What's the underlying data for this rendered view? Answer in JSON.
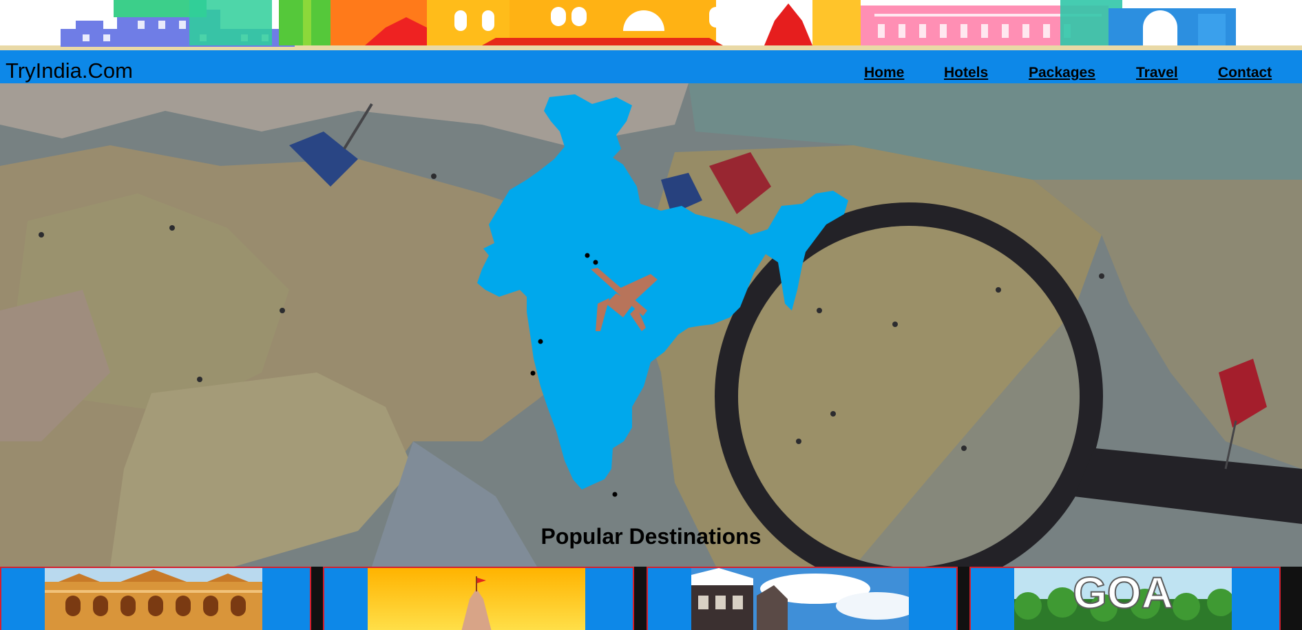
{
  "site": {
    "brand": "TryIndia.Com"
  },
  "nav": {
    "items": [
      {
        "label": "Home"
      },
      {
        "label": "Hotels"
      },
      {
        "label": "Packages"
      },
      {
        "label": "Travel"
      },
      {
        "label": "Contact"
      }
    ]
  },
  "hero": {
    "section_title": "Popular Destinations"
  },
  "cards": [
    {
      "image": "rajasthan-palace"
    },
    {
      "image": "temple-spire"
    },
    {
      "image": "hill-station"
    },
    {
      "image": "goa",
      "logo_text": "GOA"
    }
  ],
  "colors": {
    "nav_bg": "#0d88e8",
    "india_map": "#00a8ec",
    "card_border": "#d41f2e"
  }
}
